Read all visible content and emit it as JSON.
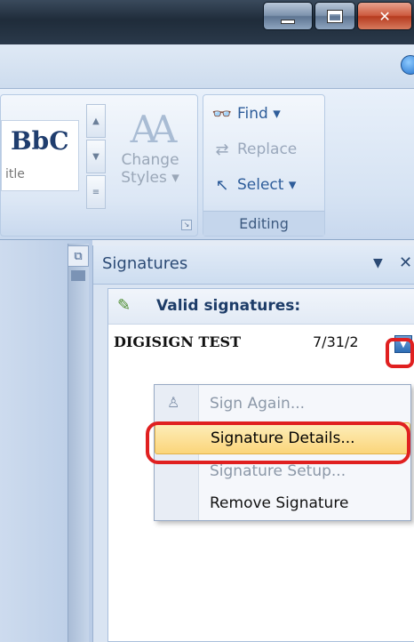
{
  "ribbon": {
    "quick_style": {
      "preview": "BbC",
      "name": "itle"
    },
    "change_styles": {
      "glyph": "AA",
      "line1": "Change",
      "line2": "Styles ▾"
    },
    "editing": {
      "find": "Find ▾",
      "replace": "Replace",
      "select": "Select ▾",
      "group_label": "Editing"
    }
  },
  "signatures_pane": {
    "title": "Signatures",
    "valid_label": "Valid signatures:",
    "signature": {
      "name": "DIGISIGN TEST",
      "date": "7/31/2"
    }
  },
  "context_menu": {
    "items": [
      {
        "label": "Sign Again...",
        "state": "disabled"
      },
      {
        "label": "Signature Details...",
        "state": "highlighted"
      },
      {
        "label": "Signature Setup...",
        "state": "disabled"
      },
      {
        "label": "Remove Signature",
        "state": "enabled"
      }
    ]
  },
  "colors": {
    "highlight_outline": "#e02020",
    "menu_hover": "#fbd57a"
  }
}
